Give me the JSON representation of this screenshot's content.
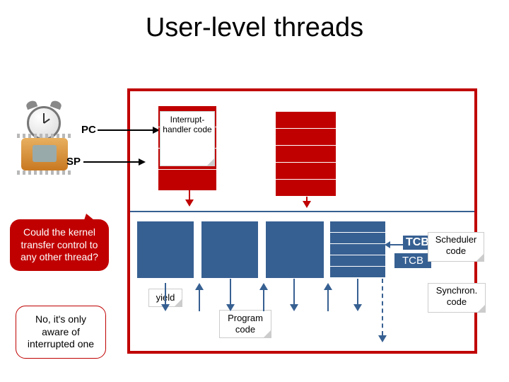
{
  "title": "User-level threads",
  "labels": {
    "pc": "PC",
    "sp": "SP"
  },
  "notes": {
    "interrupt": "Interrupt-handler code",
    "yield": "yield",
    "program": "Program code",
    "scheduler": "Scheduler code",
    "synchron": "Synchron. code"
  },
  "tcb": {
    "top": "TCB",
    "bottom": "TCB"
  },
  "callouts": {
    "question": "Could the kernel transfer control to any other thread?",
    "answer": "No, it's only aware of interrupted one"
  },
  "chart_data": {
    "type": "diagram",
    "title": "User-level threads",
    "annotations": [
      "PC",
      "SP",
      "Interrupt-handler code",
      "yield",
      "Program code",
      "TCB",
      "TCB",
      "Scheduler code",
      "Synchron. code"
    ],
    "callouts": [
      "Could the kernel transfer control to any other thread?",
      "No, it's only aware of interrupted one"
    ]
  }
}
